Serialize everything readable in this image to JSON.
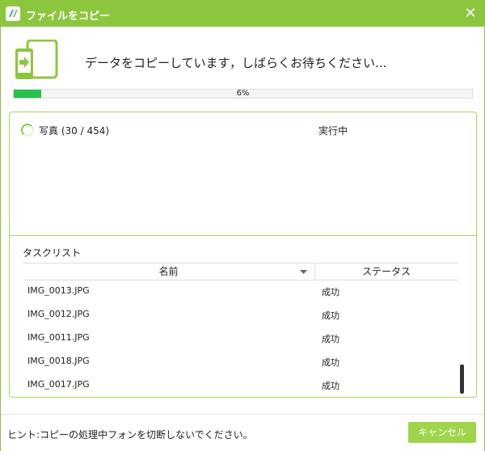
{
  "window": {
    "title": "ファイルをコピー"
  },
  "header": {
    "message": "データをコピーしています，しばらくお待ちください..."
  },
  "progress": {
    "percent": 6,
    "label": "6%"
  },
  "current": {
    "item": "写真 (30 / 454)",
    "status": "実行中"
  },
  "task_list": {
    "title": "タスクリスト",
    "columns": {
      "name": "名前",
      "status": "ステータス"
    },
    "rows": [
      {
        "name": "IMG_0013.JPG",
        "status": "成功"
      },
      {
        "name": "IMG_0012.JPG",
        "status": "成功"
      },
      {
        "name": "IMG_0011.JPG",
        "status": "成功"
      },
      {
        "name": "IMG_0018.JPG",
        "status": "成功"
      },
      {
        "name": "IMG_0017.JPG",
        "status": "成功"
      }
    ]
  },
  "footer": {
    "hint": "ヒント:コピーの処理中フォンを切断しないでください。",
    "cancel_label": "キャンセル"
  },
  "icons": {
    "app": "app-logo-icon",
    "close": "close-icon",
    "copy": "phone-tablet-transfer-icon",
    "spinner": "spinner-icon",
    "sort": "sort-down-icon"
  },
  "colors": {
    "accent": "#8cc63f",
    "progress": "#27c24c",
    "button": "#9fd54a"
  }
}
